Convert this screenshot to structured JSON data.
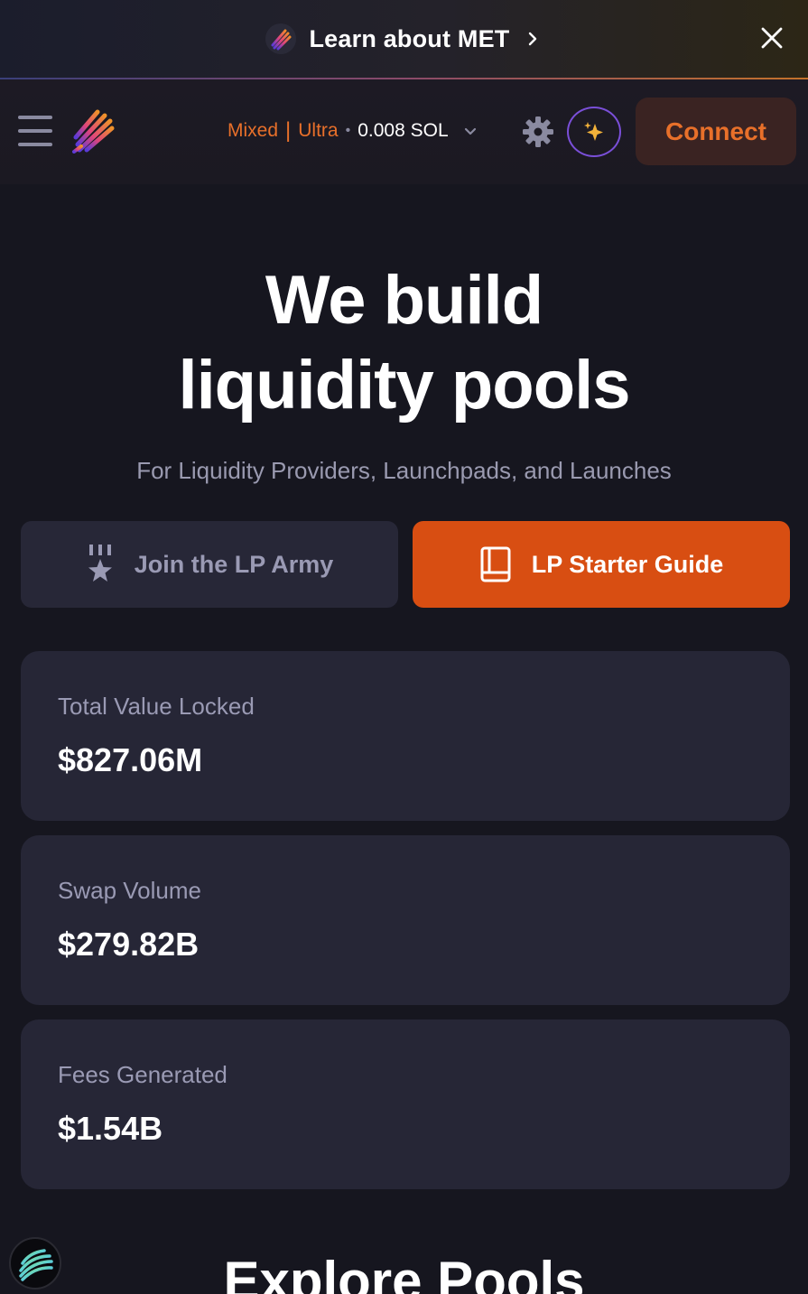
{
  "banner": {
    "text": "Learn about MET",
    "logo_icon": "met-logo-icon",
    "chevron_icon": "chevron-right-icon",
    "close_icon": "close-icon"
  },
  "header": {
    "menu_icon": "hamburger-menu-icon",
    "logo_icon": "meteora-logo-icon",
    "slippage": {
      "mode": "Mixed",
      "separator": "|",
      "speed": "Ultra",
      "dot": "•",
      "fee": "0.008 SOL"
    },
    "settings_icon": "gear-icon",
    "ai_icon": "sparkle-icon",
    "connect_label": "Connect"
  },
  "hero": {
    "title_line1": "We build",
    "title_line2": "liquidity pools",
    "subtitle": "For Liquidity Providers, Launchpads, and Launches"
  },
  "cta": {
    "army_label": "Join the LP Army",
    "army_icon": "medal-star-icon",
    "guide_label": "LP Starter Guide",
    "guide_icon": "book-icon"
  },
  "stats": [
    {
      "label": "Total Value Locked",
      "value": "$827.06M"
    },
    {
      "label": "Swap Volume",
      "value": "$279.82B"
    },
    {
      "label": "Fees Generated",
      "value": "$1.54B"
    }
  ],
  "explore": {
    "title": "Explore Pools"
  },
  "colors": {
    "accent": "#d84e12",
    "accent_text": "#e8702a",
    "card_bg": "#262636",
    "page_bg": "#16161f"
  }
}
